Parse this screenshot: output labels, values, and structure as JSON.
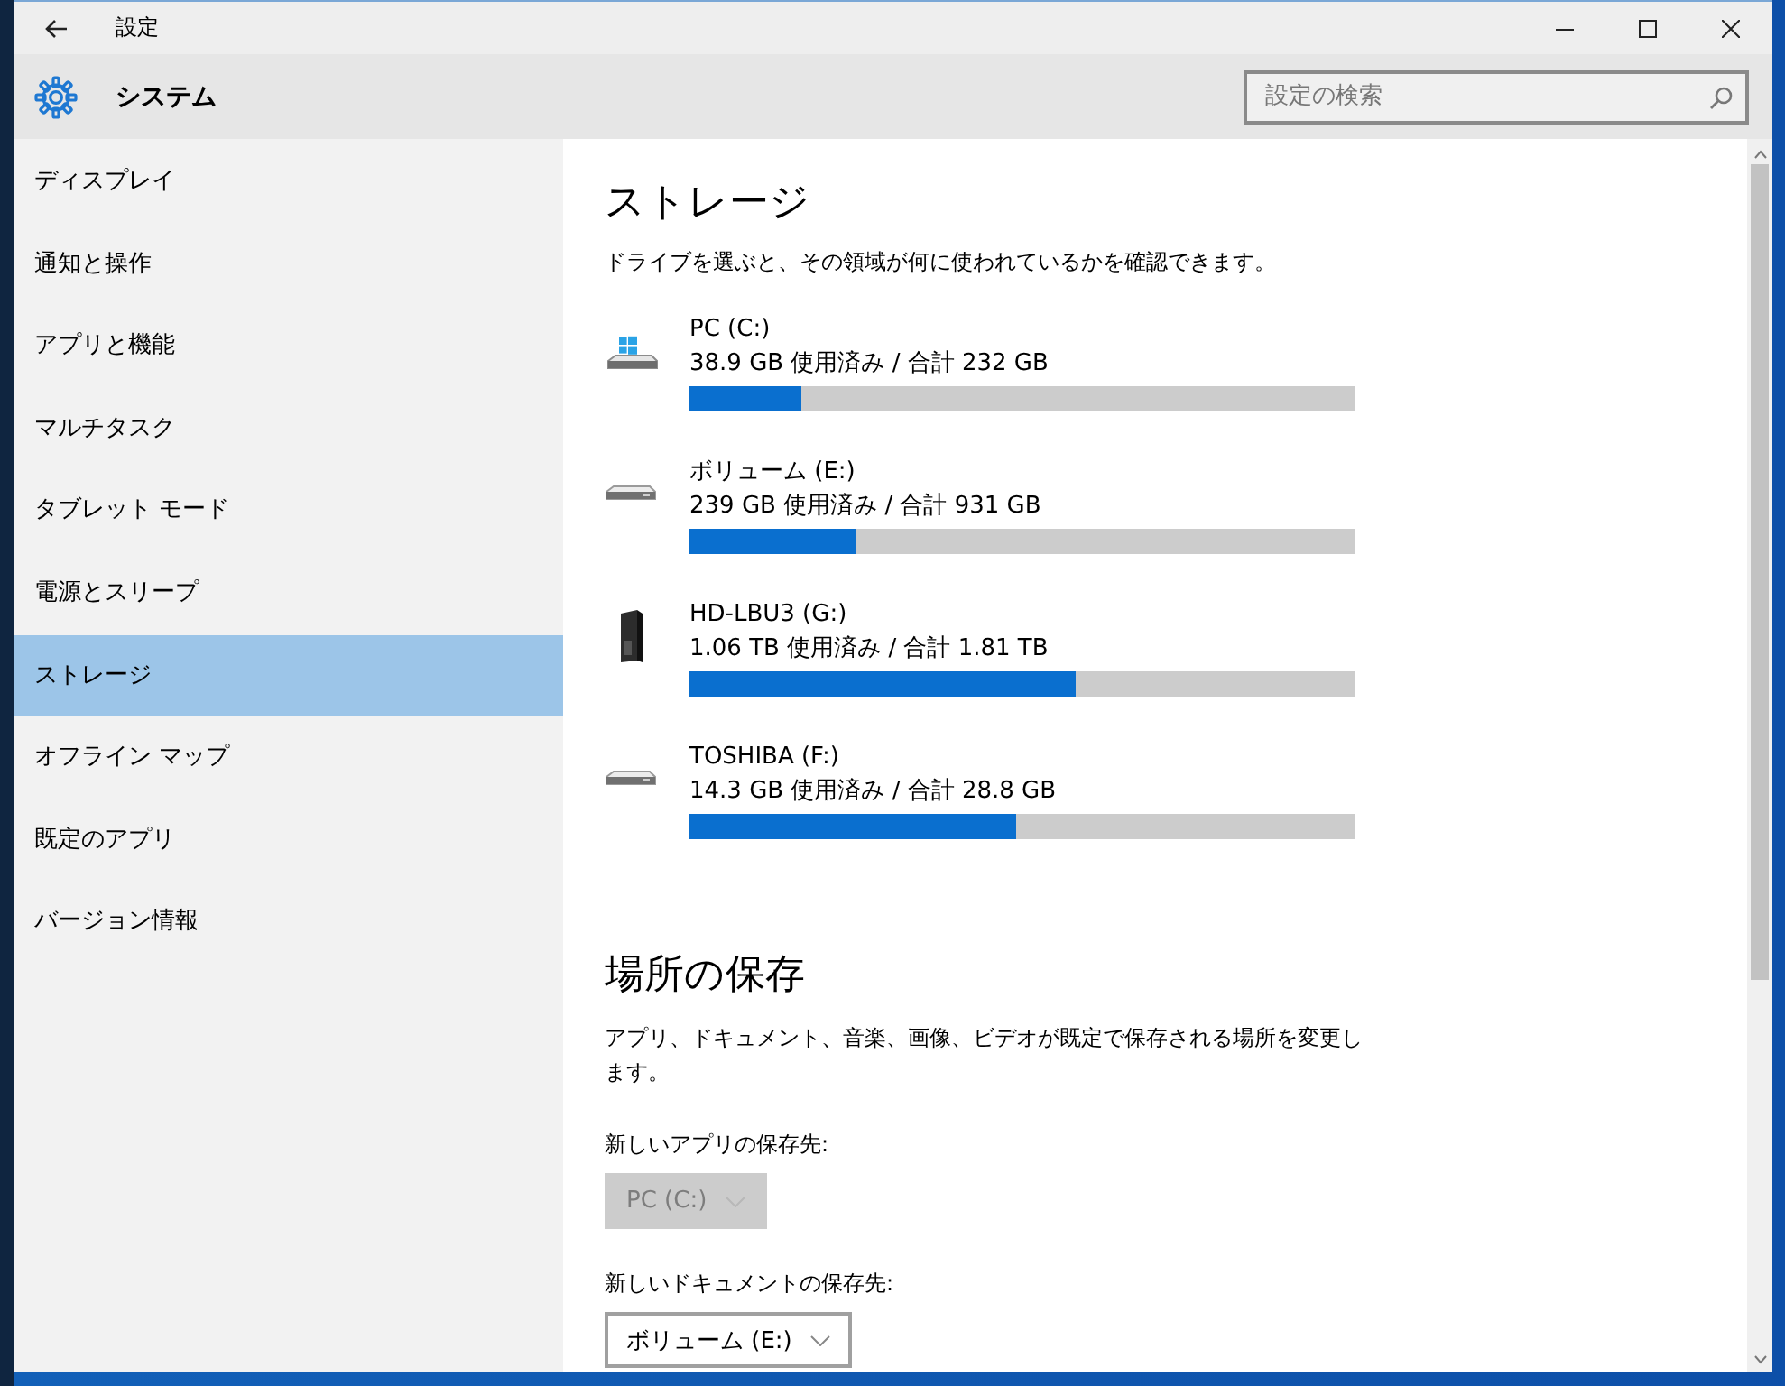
{
  "window": {
    "title": "設定"
  },
  "header": {
    "section": "システム",
    "search": {
      "placeholder": "設定の検索"
    }
  },
  "sidebar": {
    "items": [
      {
        "label": "ディスプレイ",
        "selected": false
      },
      {
        "label": "通知と操作",
        "selected": false
      },
      {
        "label": "アプリと機能",
        "selected": false
      },
      {
        "label": "マルチタスク",
        "selected": false
      },
      {
        "label": "タブレット モード",
        "selected": false
      },
      {
        "label": "電源とスリープ",
        "selected": false
      },
      {
        "label": "ストレージ",
        "selected": true
      },
      {
        "label": "オフライン マップ",
        "selected": false
      },
      {
        "label": "既定のアプリ",
        "selected": false
      },
      {
        "label": "バージョン情報",
        "selected": false
      }
    ]
  },
  "storage": {
    "title": "ストレージ",
    "description": "ドライブを選ぶと、その領域が何に使われているかを確認できます。",
    "drives": [
      {
        "kind": "system",
        "name": "PC (C:)",
        "usage": "38.9 GB 使用済み / 合計 232 GB",
        "level": 0.168
      },
      {
        "kind": "disk",
        "name": "ボリューム (E:)",
        "usage": "239 GB 使用済み / 合計 931 GB",
        "level": 0.25
      },
      {
        "kind": "external",
        "name": "HD-LBU3 (G:)",
        "usage": "1.06 TB 使用済み / 合計 1.81 TB",
        "level": 0.58
      },
      {
        "kind": "disk",
        "name": "TOSHIBA (F:)",
        "usage": "14.3 GB 使用済み / 合計 28.8 GB",
        "level": 0.49
      }
    ]
  },
  "save_locations": {
    "title": "場所の保存",
    "description": "アプリ、ドキュメント、音楽、画像、ビデオが既定で保存される場所を変更します。",
    "settings": [
      {
        "label": "新しいアプリの保存先:",
        "value": "PC (C:)",
        "disabled": true
      },
      {
        "label": "新しいドキュメントの保存先:",
        "value": "ボリューム (E:)",
        "disabled": false
      }
    ]
  }
}
